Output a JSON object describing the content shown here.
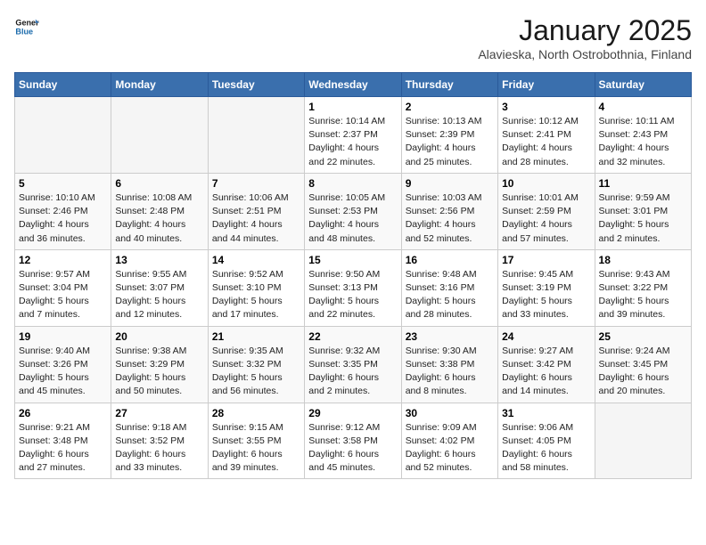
{
  "logo": {
    "line1": "General",
    "line2": "Blue"
  },
  "title": "January 2025",
  "subtitle": "Alavieska, North Ostrobothnia, Finland",
  "days_of_week": [
    "Sunday",
    "Monday",
    "Tuesday",
    "Wednesday",
    "Thursday",
    "Friday",
    "Saturday"
  ],
  "weeks": [
    [
      {
        "day": "",
        "info": ""
      },
      {
        "day": "",
        "info": ""
      },
      {
        "day": "",
        "info": ""
      },
      {
        "day": "1",
        "info": "Sunrise: 10:14 AM\nSunset: 2:37 PM\nDaylight: 4 hours\nand 22 minutes."
      },
      {
        "day": "2",
        "info": "Sunrise: 10:13 AM\nSunset: 2:39 PM\nDaylight: 4 hours\nand 25 minutes."
      },
      {
        "day": "3",
        "info": "Sunrise: 10:12 AM\nSunset: 2:41 PM\nDaylight: 4 hours\nand 28 minutes."
      },
      {
        "day": "4",
        "info": "Sunrise: 10:11 AM\nSunset: 2:43 PM\nDaylight: 4 hours\nand 32 minutes."
      }
    ],
    [
      {
        "day": "5",
        "info": "Sunrise: 10:10 AM\nSunset: 2:46 PM\nDaylight: 4 hours\nand 36 minutes."
      },
      {
        "day": "6",
        "info": "Sunrise: 10:08 AM\nSunset: 2:48 PM\nDaylight: 4 hours\nand 40 minutes."
      },
      {
        "day": "7",
        "info": "Sunrise: 10:06 AM\nSunset: 2:51 PM\nDaylight: 4 hours\nand 44 minutes."
      },
      {
        "day": "8",
        "info": "Sunrise: 10:05 AM\nSunset: 2:53 PM\nDaylight: 4 hours\nand 48 minutes."
      },
      {
        "day": "9",
        "info": "Sunrise: 10:03 AM\nSunset: 2:56 PM\nDaylight: 4 hours\nand 52 minutes."
      },
      {
        "day": "10",
        "info": "Sunrise: 10:01 AM\nSunset: 2:59 PM\nDaylight: 4 hours\nand 57 minutes."
      },
      {
        "day": "11",
        "info": "Sunrise: 9:59 AM\nSunset: 3:01 PM\nDaylight: 5 hours\nand 2 minutes."
      }
    ],
    [
      {
        "day": "12",
        "info": "Sunrise: 9:57 AM\nSunset: 3:04 PM\nDaylight: 5 hours\nand 7 minutes."
      },
      {
        "day": "13",
        "info": "Sunrise: 9:55 AM\nSunset: 3:07 PM\nDaylight: 5 hours\nand 12 minutes."
      },
      {
        "day": "14",
        "info": "Sunrise: 9:52 AM\nSunset: 3:10 PM\nDaylight: 5 hours\nand 17 minutes."
      },
      {
        "day": "15",
        "info": "Sunrise: 9:50 AM\nSunset: 3:13 PM\nDaylight: 5 hours\nand 22 minutes."
      },
      {
        "day": "16",
        "info": "Sunrise: 9:48 AM\nSunset: 3:16 PM\nDaylight: 5 hours\nand 28 minutes."
      },
      {
        "day": "17",
        "info": "Sunrise: 9:45 AM\nSunset: 3:19 PM\nDaylight: 5 hours\nand 33 minutes."
      },
      {
        "day": "18",
        "info": "Sunrise: 9:43 AM\nSunset: 3:22 PM\nDaylight: 5 hours\nand 39 minutes."
      }
    ],
    [
      {
        "day": "19",
        "info": "Sunrise: 9:40 AM\nSunset: 3:26 PM\nDaylight: 5 hours\nand 45 minutes."
      },
      {
        "day": "20",
        "info": "Sunrise: 9:38 AM\nSunset: 3:29 PM\nDaylight: 5 hours\nand 50 minutes."
      },
      {
        "day": "21",
        "info": "Sunrise: 9:35 AM\nSunset: 3:32 PM\nDaylight: 5 hours\nand 56 minutes."
      },
      {
        "day": "22",
        "info": "Sunrise: 9:32 AM\nSunset: 3:35 PM\nDaylight: 6 hours\nand 2 minutes."
      },
      {
        "day": "23",
        "info": "Sunrise: 9:30 AM\nSunset: 3:38 PM\nDaylight: 6 hours\nand 8 minutes."
      },
      {
        "day": "24",
        "info": "Sunrise: 9:27 AM\nSunset: 3:42 PM\nDaylight: 6 hours\nand 14 minutes."
      },
      {
        "day": "25",
        "info": "Sunrise: 9:24 AM\nSunset: 3:45 PM\nDaylight: 6 hours\nand 20 minutes."
      }
    ],
    [
      {
        "day": "26",
        "info": "Sunrise: 9:21 AM\nSunset: 3:48 PM\nDaylight: 6 hours\nand 27 minutes."
      },
      {
        "day": "27",
        "info": "Sunrise: 9:18 AM\nSunset: 3:52 PM\nDaylight: 6 hours\nand 33 minutes."
      },
      {
        "day": "28",
        "info": "Sunrise: 9:15 AM\nSunset: 3:55 PM\nDaylight: 6 hours\nand 39 minutes."
      },
      {
        "day": "29",
        "info": "Sunrise: 9:12 AM\nSunset: 3:58 PM\nDaylight: 6 hours\nand 45 minutes."
      },
      {
        "day": "30",
        "info": "Sunrise: 9:09 AM\nSunset: 4:02 PM\nDaylight: 6 hours\nand 52 minutes."
      },
      {
        "day": "31",
        "info": "Sunrise: 9:06 AM\nSunset: 4:05 PM\nDaylight: 6 hours\nand 58 minutes."
      },
      {
        "day": "",
        "info": ""
      }
    ]
  ]
}
